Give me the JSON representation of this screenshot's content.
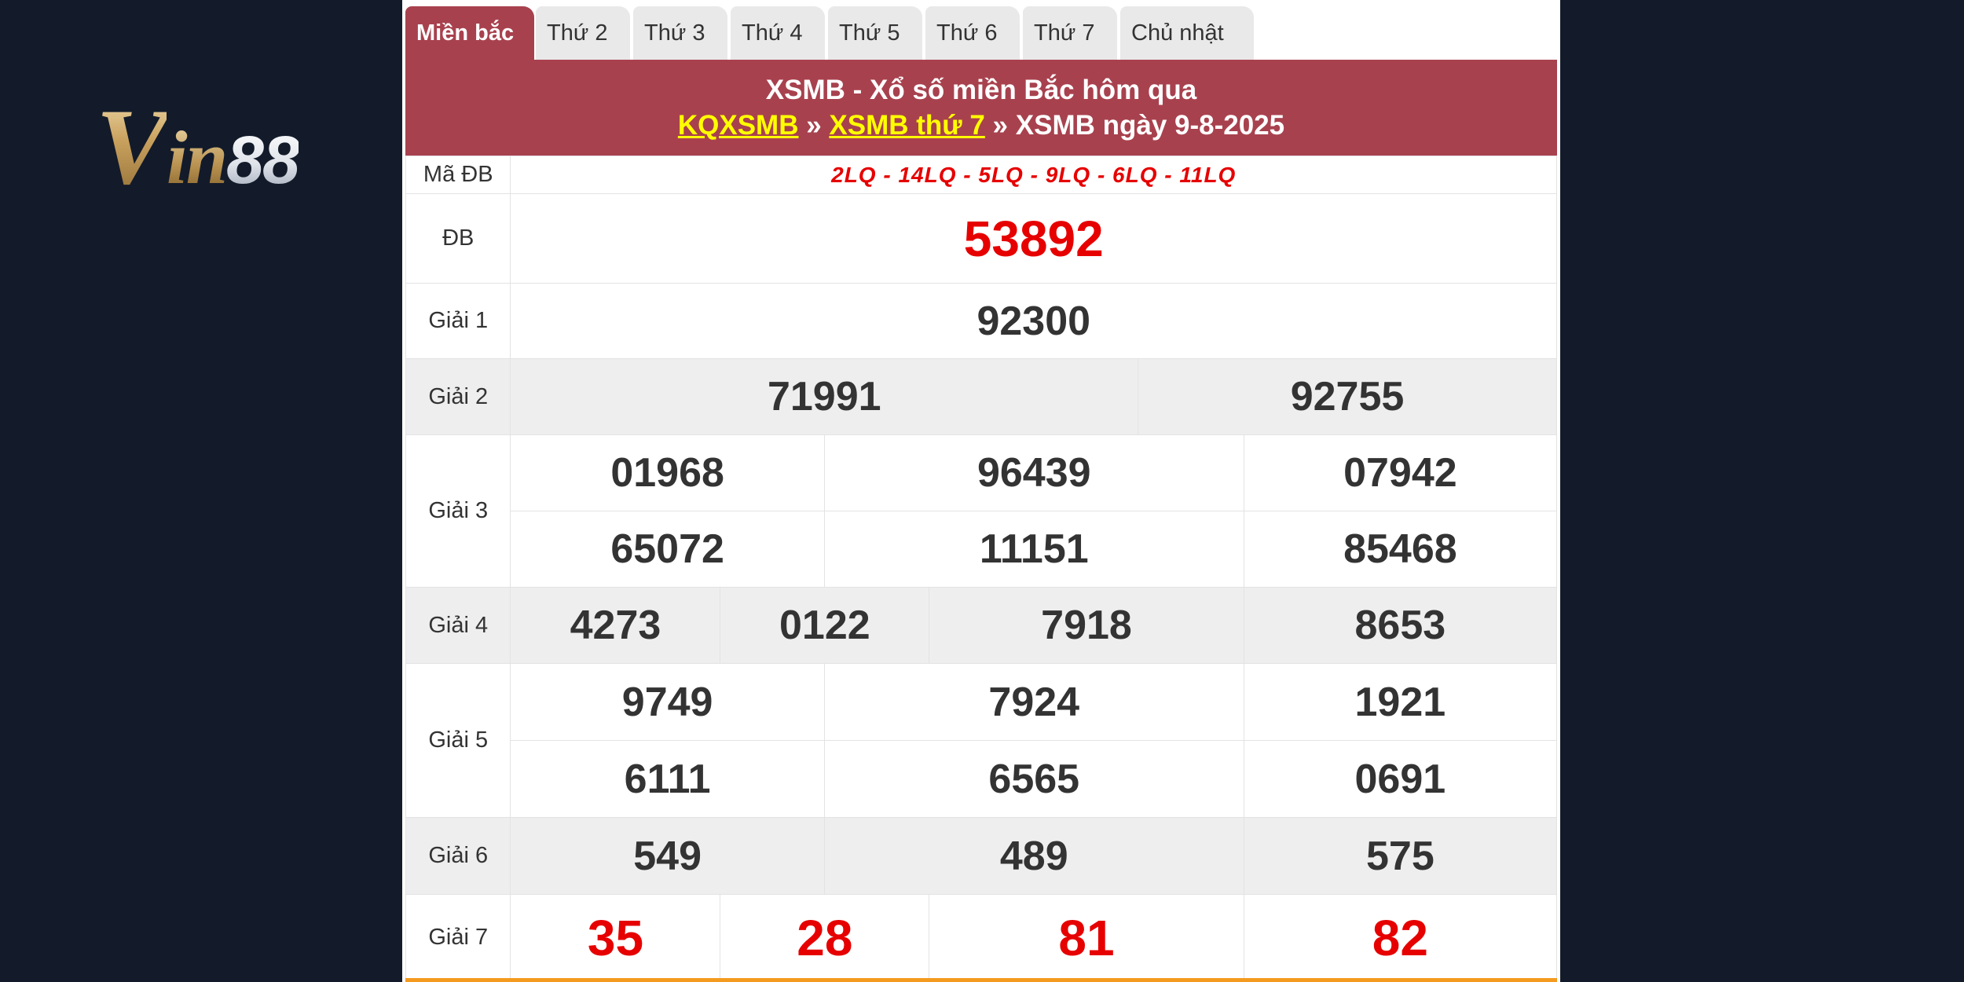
{
  "logo": {
    "v": "V",
    "in": "in",
    "num": "88"
  },
  "tabs": [
    "Miền bắc",
    "Thứ 2",
    "Thứ 3",
    "Thứ 4",
    "Thứ 5",
    "Thứ 6",
    "Thứ 7",
    "Chủ nhật"
  ],
  "banner": {
    "title": "XSMB - Xổ số miền Bắc hôm qua",
    "crumb1": "KQXSMB",
    "sep1": " » ",
    "crumb2": "XSMB thứ 7",
    "sep2": " » ",
    "crumb3": "XSMB ngày 9-8-2025"
  },
  "results": {
    "ma_db_label": "Mã ĐB",
    "ma_db": "2LQ - 14LQ - 5LQ - 9LQ - 6LQ - 11LQ",
    "db_label": "ĐB",
    "db": "53892",
    "g1_label": "Giải 1",
    "g1": "92300",
    "g2_label": "Giải 2",
    "g2": [
      "71991",
      "92755"
    ],
    "g3_label": "Giải 3",
    "g3": [
      "01968",
      "96439",
      "07942",
      "65072",
      "11151",
      "85468"
    ],
    "g4_label": "Giải 4",
    "g4": [
      "4273",
      "0122",
      "7918",
      "8653"
    ],
    "g5_label": "Giải 5",
    "g5": [
      "9749",
      "7924",
      "1921",
      "6111",
      "6565",
      "0691"
    ],
    "g6_label": "Giải 6",
    "g6": [
      "549",
      "489",
      "575"
    ],
    "g7_label": "Giải 7",
    "g7": [
      "35",
      "28",
      "81",
      "82"
    ]
  },
  "colors": {
    "accent": "#a8414e",
    "highlight": "#e60000",
    "link": "#ffff00",
    "background": "#131b2a"
  }
}
